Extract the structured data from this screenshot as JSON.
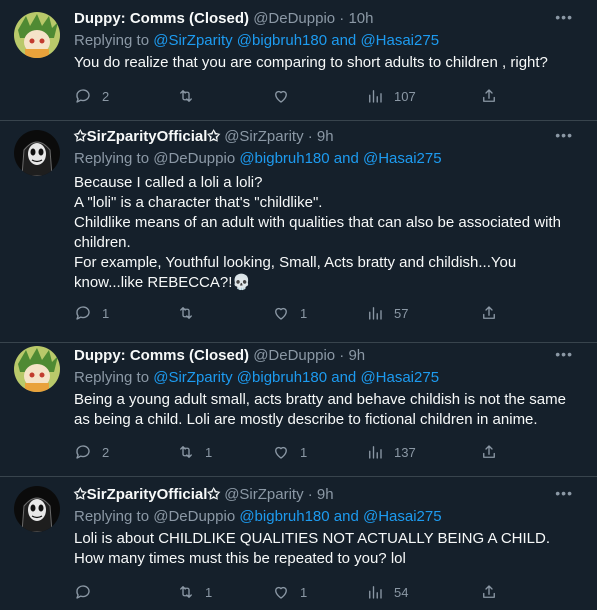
{
  "tweets": [
    {
      "name": "Duppy: Comms (Closed)",
      "handle": "@DeDuppio",
      "time": "· 10h",
      "replying_prefix": "Replying to",
      "replying_to": "@SirZparity @bigbruh180 and @Hasai275",
      "text": "You do realize that you are comparing to short adults to children , right?",
      "replies": "2",
      "retweets": "",
      "likes": "",
      "views": "107"
    },
    {
      "name": "✩SirZparityOfficial✩",
      "handle": "@SirZparity",
      "time": "· 9h",
      "replying_prefix": "Replying to",
      "replying_user": "@DeDuppio",
      "replying_rest": "@bigbruh180 and @Hasai275",
      "lines": [
        "Because I called a loli a loli?",
        "A \"loli\" is a character that's \"childlike\".",
        "Childlike means of an adult with qualities that can also be associated with children.",
        "For example, Youthful looking, Small, Acts bratty and childish...You know...like REBECCA?!💀"
      ],
      "replies": "1",
      "retweets": "",
      "likes": "1",
      "views": "57"
    },
    {
      "name": "Duppy: Comms (Closed)",
      "handle": "@DeDuppio",
      "time": "· 9h",
      "replying_prefix": "Replying to",
      "replying_to": "@SirZparity @bigbruh180 and @Hasai275",
      "text": "Being a young adult small, acts bratty and behave childish is not the same as being a child. Loli are mostly describe to fictional children in anime.",
      "replies": "2",
      "retweets": "1",
      "likes": "1",
      "views": "137"
    },
    {
      "name": "✩SirZparityOfficial✩",
      "handle": "@SirZparity",
      "time": "· 9h",
      "replying_prefix": "Replying to",
      "replying_user": "@DeDuppio",
      "replying_rest": "@bigbruh180 and @Hasai275",
      "text": "Loli is about CHILDLIKE QUALITIES NOT ACTUALLY BEING A CHILD. How many times must this be repeated to you? lol",
      "replies": "",
      "retweets": "1",
      "likes": "1",
      "views": "54"
    }
  ],
  "icons": {
    "reply": "reply-icon",
    "retweet": "retweet-icon",
    "like": "heart-icon",
    "views": "views-icon",
    "share": "share-icon",
    "more": "more-icon"
  },
  "colors": {
    "background": "#15202b",
    "mention": "#1d9bf0",
    "muted": "#8b98a5",
    "text": "#f7f9f9"
  }
}
